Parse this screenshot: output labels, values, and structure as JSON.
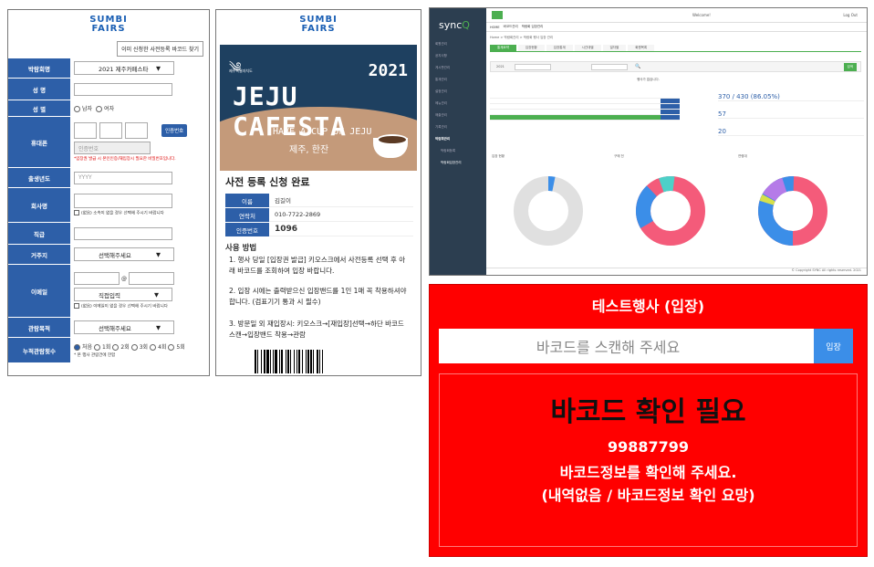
{
  "form": {
    "logo_line1": "SUMBI",
    "logo_line2": "FAIRS",
    "find_button": "이미 신청한 사전등록 바코드 찾기",
    "event_label": "박람회명",
    "event_value": "2021 제주카페스타",
    "name_label": "성 명",
    "gender_label": "성 별",
    "gender_male": "남자",
    "gender_female": "여자",
    "phone_label": "휴대폰",
    "auth_button": "인증번호",
    "auth_placeholder": "인증번호",
    "auth_note": "*입장권 발급 시 본인인증/재입장시 필요한 비밀번호입니다.",
    "birth_label": "출생년도",
    "birth_placeholder": "YYYY",
    "company_label": "회사명",
    "company_note": "(없음) 소속이 없을 경우 선택해 주시기 바랍니다",
    "position_label": "직급",
    "region_label": "거주지",
    "region_value": "선택해주세요",
    "email_label": "이메일",
    "email_at": "@",
    "email_direct": "직접입력",
    "email_note": "(없음) 이메일이 없을 경우 선택해 주시기 바랍니다",
    "purpose_label": "관람목적",
    "purpose_value": "선택해주세요",
    "visits_label": "누적관람횟수",
    "visits_options": [
      "처음",
      "1회",
      "2회",
      "3회",
      "4회",
      "5회"
    ],
    "visits_note": "* 본 행사 관람건에 한함"
  },
  "ticket": {
    "logo_line1": "SUMBI",
    "logo_line2": "FAIRS",
    "banner_emblem_text": "제주특별자치도",
    "banner_year": "2021",
    "banner_title": "JEJU CAFESTA",
    "banner_sub1": "HAVE A CUP OF JEJU",
    "banner_sub2": "제주, 한잔",
    "heading": "사전 등록 신청 완료",
    "rows": [
      {
        "label": "이름",
        "value": "김길이"
      },
      {
        "label": "연락처",
        "value": "010-7722-2869"
      },
      {
        "label": "인증번호",
        "value": "1096"
      }
    ],
    "usage_title": "사용 방법",
    "step1": "1. 행사 당일 [입장권 발급] 키오스크에서 사전등록 선택 후 아래 바코드를 조회하여 입장 바랍니다.",
    "step2": "2. 입장 시에는 출력받으신 입장밴드를 1인 1매 꼭 착용하셔야 합니다. (검표기기 통과 시 필수)",
    "step3": "3. 방문일 외 재입장시: 키오스크→[재입장]선택→하단 바코드 스캔→입장밴드 착용→관람"
  },
  "dashboard": {
    "logo": "sync",
    "welcome": "Welcome!",
    "topbar_right": "Log Out",
    "nav_items": [
      "HOME",
      "바코드관리",
      "박람회 입장관리"
    ],
    "sidebar_items": [
      "회원관리",
      "공지사항",
      "게시판관리",
      "통계관리",
      "설정관리",
      "메뉴관리",
      "매출관리",
      "기록관리",
      "박람회관리"
    ],
    "sidebar_sub": [
      "박람회등록",
      "박람회입장관리"
    ],
    "crumbs": "Home > 박람회관리 > 박람회 행사 입장 관리",
    "tabs": [
      "통계요약",
      "입장현황",
      "입장통계",
      "시간대별",
      "일자별",
      "회원목록"
    ],
    "filter_year": "2021",
    "filter_btn": "검색",
    "notice": "행사가 없습니다.",
    "stat1": "370 / 430 (86.05%)",
    "stat2": "57",
    "stat3": "20",
    "chart_titles": [
      "입장 현황",
      "구매 전",
      "연령대"
    ],
    "footer": "© Copyright SYNC All rights reserved. 2021"
  },
  "scanner": {
    "title": "테스트행사 (입장)",
    "placeholder": "바코드를 스캔해 주세요",
    "button": "입장",
    "result_title": "바코드 확인 필요",
    "barcode": "99887799",
    "message": "바코드정보를 확인해 주세요.",
    "detail": "(내역없음 / 바코드정보 확인 요망)"
  },
  "colors": {
    "form_label_blue": "#2d5fa8",
    "scanner_red": "#ff0000",
    "scanner_button": "#3b8ee8",
    "dashboard_green": "#4caf50"
  }
}
